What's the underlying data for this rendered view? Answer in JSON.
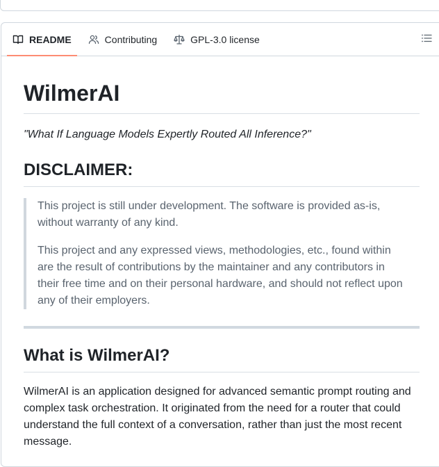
{
  "tabs": [
    {
      "label": "README",
      "icon": "book-icon",
      "active": true
    },
    {
      "label": "Contributing",
      "icon": "people-icon",
      "active": false
    },
    {
      "label": "GPL-3.0 license",
      "icon": "law-icon",
      "active": false
    }
  ],
  "readme": {
    "title": "WilmerAI",
    "tagline": "\"What If Language Models Expertly Routed All Inference?\"",
    "disclaimer_heading": "DISCLAIMER:",
    "disclaimer_p1": "This project is still under development. The software is provided as-is, without warranty of any kind.",
    "disclaimer_p2": "This project and any expressed views, methodologies, etc., found within are the result of contributions by the maintainer and any contributors in their free time and on their personal hardware, and should not reflect upon any of their employers.",
    "what_heading": "What is WilmerAI?",
    "what_p1": "WilmerAI is an application designed for advanced semantic prompt routing and complex task orchestration. It originated from the need for a router that could understand the full context of a conversation, rather than just the most recent message."
  },
  "colors": {
    "active_tab_underline": "#fd8c73",
    "border": "#d0d7de",
    "muted_text": "#59636e"
  }
}
